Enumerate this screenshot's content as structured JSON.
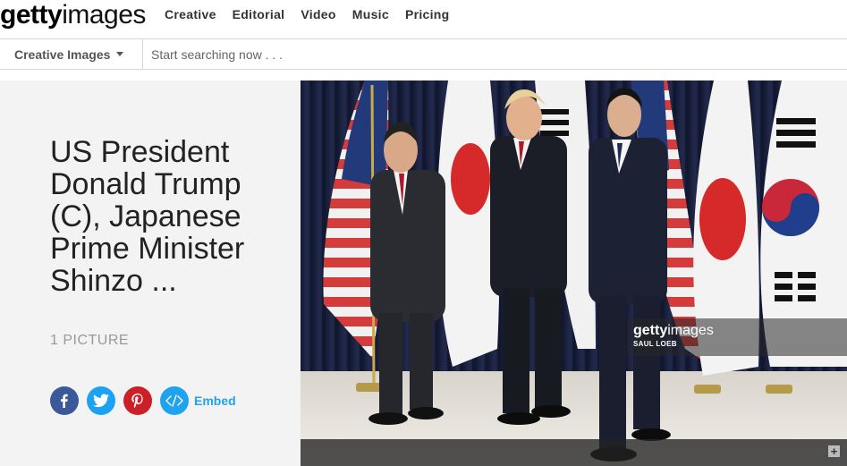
{
  "header": {
    "logo_bold": "getty",
    "logo_thin": "images",
    "nav": [
      "Creative",
      "Editorial",
      "Video",
      "Music",
      "Pricing"
    ]
  },
  "search": {
    "scope_label": "Creative Images",
    "placeholder": "Start searching now . . ."
  },
  "board": {
    "title": "US President Donald Trump (C), Japanese Prime Minister Shinzo ...",
    "picture_count": "1 PICTURE",
    "embed_label": "Embed"
  },
  "photo": {
    "watermark_bold": "getty",
    "watermark_thin": "images",
    "credit": "SAUL LOEB"
  },
  "colors": {
    "facebook": "#3b5998",
    "twitter": "#1da1f2",
    "pinterest": "#cb2027",
    "embed": "#1fa3f0"
  }
}
